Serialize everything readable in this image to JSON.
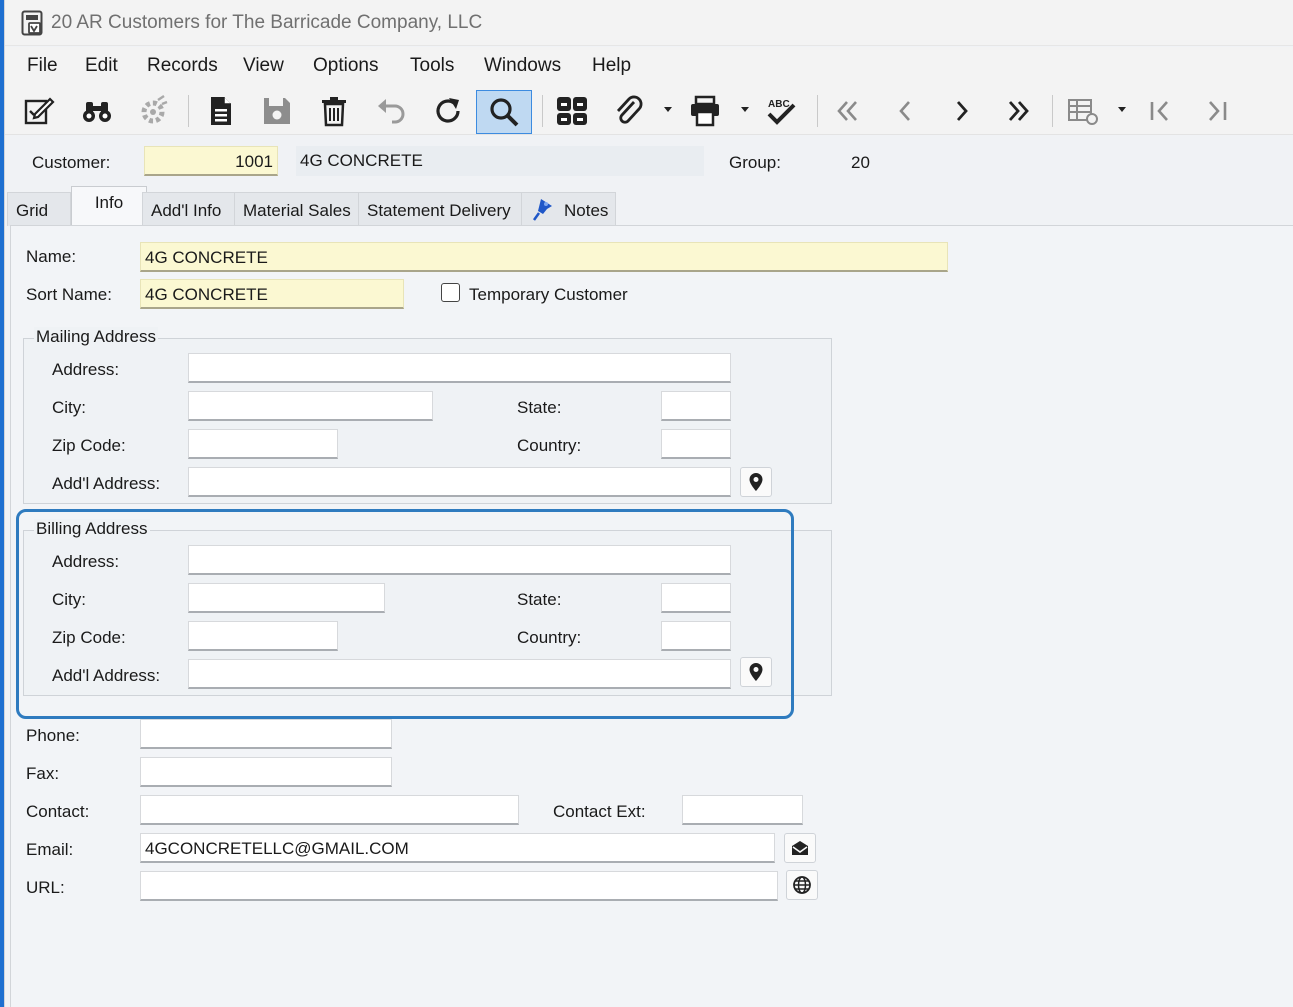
{
  "window": {
    "title": "20 AR Customers for The Barricade Company, LLC"
  },
  "menu": [
    "File",
    "Edit",
    "Records",
    "View",
    "Options",
    "Tools",
    "Windows",
    "Help"
  ],
  "toolbar": {
    "icons": [
      "edit-icon",
      "binoculars-icon",
      "settings-bug-icon",
      "new-document-icon",
      "save-icon",
      "delete-icon",
      "undo-icon",
      "refresh-icon",
      "search-icon",
      "layout-icon",
      "attach-icon",
      "print-icon",
      "spellcheck-icon",
      "first-page-icon",
      "prev-icon",
      "next-icon",
      "last-page-icon",
      "grid-settings-icon",
      "first-record-icon",
      "last-record-icon"
    ],
    "spellcheck_text": "ABC"
  },
  "header": {
    "customer_label": "Customer:",
    "customer_number": "1001",
    "customer_name": "4G CONCRETE",
    "group_label": "Group:",
    "group_value": "20"
  },
  "tabs": [
    "Grid",
    "Info",
    "Add'l Info",
    "Material Sales",
    "Statement Delivery",
    "Notes"
  ],
  "active_tab": "Info",
  "info": {
    "name_label": "Name:",
    "name_value": "4G CONCRETE",
    "sort_name_label": "Sort Name:",
    "sort_name_value": "4G CONCRETE",
    "temporary_customer_label": "Temporary Customer",
    "temporary_customer_checked": false
  },
  "mailing": {
    "title": "Mailing Address",
    "address_label": "Address:",
    "address_value": "",
    "city_label": "City:",
    "city_value": "",
    "state_label": "State:",
    "state_value": "",
    "zip_label": "Zip Code:",
    "zip_value": "",
    "country_label": "Country:",
    "country_value": "",
    "addl_label": "Add'l Address:",
    "addl_value": ""
  },
  "billing": {
    "title": "Billing Address",
    "address_label": "Address:",
    "address_value": "",
    "city_label": "City:",
    "city_value": "",
    "state_label": "State:",
    "state_value": "",
    "zip_label": "Zip Code:",
    "zip_value": "",
    "country_label": "Country:",
    "country_value": "",
    "addl_label": "Add'l Address:",
    "addl_value": ""
  },
  "contact": {
    "phone_label": "Phone:",
    "phone_value": "",
    "fax_label": "Fax:",
    "fax_value": "",
    "contact_label": "Contact:",
    "contact_value": "",
    "contact_ext_label": "Contact Ext:",
    "contact_ext_value": "",
    "email_label": "Email:",
    "email_value": "4GCONCRETELLC@GMAIL.COM",
    "url_label": "URL:",
    "url_value": ""
  },
  "colors": {
    "accent": "#2f7bbf",
    "highlight_fill": "#bfd9f2",
    "required_field": "#fbf8d2"
  }
}
